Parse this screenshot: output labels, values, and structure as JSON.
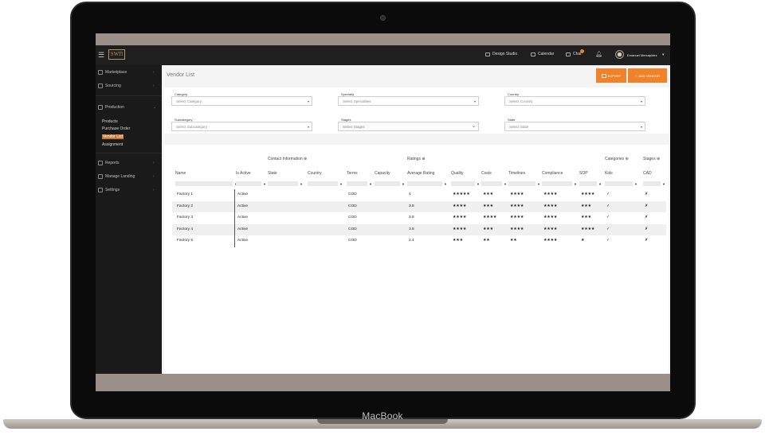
{
  "device": {
    "brand_label": "MacBook"
  },
  "topbar": {
    "logo_text": "SWΠ",
    "design_studio": "Design Studio",
    "calendar": "Calendar",
    "chat": "Chat",
    "user_name": "Emanuel Mercapidez"
  },
  "sidebar": {
    "marketplace": "Marketplace",
    "sourcing": "Sourcing",
    "production": "Production",
    "sub_items": [
      "Products",
      "Purchase Order",
      "Vendor List",
      "Assignment"
    ],
    "reports": "Reports",
    "manage_landing": "Manage Landing",
    "settings": "Settings"
  },
  "page": {
    "title": "Vendor List",
    "export_label": "EXPORT",
    "add_vendor_label": "ADD VENDOR"
  },
  "filters": {
    "category": {
      "label": "Category",
      "placeholder": "Select Category"
    },
    "specialty": {
      "label": "Specialty",
      "placeholder": "Select Specialties"
    },
    "country": {
      "label": "Country",
      "placeholder": "Select Country"
    },
    "subcategory": {
      "label": "Subcategory",
      "placeholder": "Select Subcategory"
    },
    "stages": {
      "label": "Stages",
      "placeholder": "Select Stages"
    },
    "state": {
      "label": "State",
      "placeholder": "Select State"
    }
  },
  "table": {
    "groups": {
      "contact": "Contact Information ⊕",
      "ratings": "Ratings ⊕",
      "categories": "Categories ⊕",
      "stages": "Stages ⊕"
    },
    "columns": [
      "Name",
      "Is Active",
      "State",
      "Country",
      "Terms",
      "Capacity",
      "Average Rating",
      "Quality",
      "Costs",
      "Timelines",
      "Compliance",
      "SOP",
      "Kids",
      "CAD"
    ],
    "rows": [
      {
        "name": "Factory 1",
        "active": "Active",
        "terms": "COD",
        "avg": "4",
        "quality": "★★★★★",
        "costs": "★★★",
        "timelines": "★★★★",
        "compliance": "★★★★",
        "sop": "★★★★",
        "kids": "✓",
        "cad": "✗"
      },
      {
        "name": "Factory 2",
        "active": "Active",
        "terms": "COD",
        "avg": "3.8",
        "quality": "★★★★",
        "costs": "★★★",
        "timelines": "★★★★",
        "compliance": "★★★★",
        "sop": "★★★",
        "kids": "✓",
        "cad": "✗"
      },
      {
        "name": "Factory 3",
        "active": "Active",
        "terms": "COD",
        "avg": "3.8",
        "quality": "★★★★",
        "costs": "★★★★",
        "timelines": "★★★★",
        "compliance": "★★★★",
        "sop": "★★★",
        "kids": "✓",
        "cad": "✗"
      },
      {
        "name": "Factory 4",
        "active": "Active",
        "terms": "COD",
        "avg": "3.8",
        "quality": "★★★★",
        "costs": "★★★",
        "timelines": "★★★★",
        "compliance": "★★★★",
        "sop": "★★★★",
        "kids": "✓",
        "cad": "✗"
      },
      {
        "name": "Factory 5",
        "active": "Active",
        "terms": "COD",
        "avg": "2.4",
        "quality": "★★★",
        "costs": "★★",
        "timelines": "★★",
        "compliance": "★★★★",
        "sop": "★",
        "kids": "✓",
        "cad": "✗"
      }
    ]
  },
  "colors": {
    "accent": "#f0832a",
    "sidebar_bg": "#1a1a1a",
    "topbar_bg": "#1f1f1f",
    "frame_bg": "#9a8f89"
  }
}
